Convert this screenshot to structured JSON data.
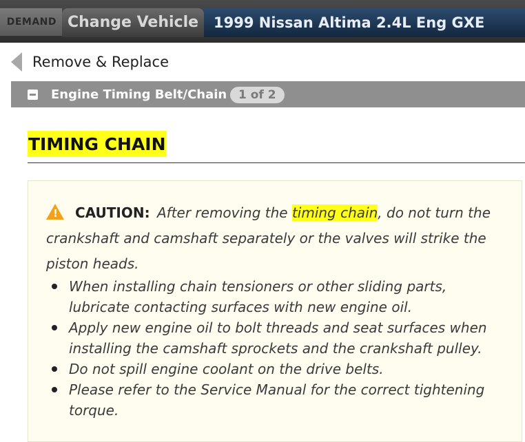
{
  "header": {
    "brand": "DEMAND",
    "change_vehicle_label": "Change Vehicle",
    "vehicle": "1999 Nissan Altima 2.4L Eng GXE"
  },
  "nav": {
    "back_label": "Remove & Replace"
  },
  "section": {
    "title": "Engine Timing Belt/Chain",
    "pager": "1 of 2"
  },
  "content": {
    "heading": "TIMING CHAIN",
    "caution": {
      "label": "CAUTION:",
      "text_before": "After removing the",
      "highlight": "timing chain",
      "text_after": ", do not turn the crankshaft and camshaft separately or the valves will strike the piston heads."
    },
    "bullets": [
      "When installing chain tensioners or other sliding parts, lubricate contacting surfaces with new engine oil.",
      "Apply new engine oil to bolt threads and seat surfaces when installing the camshaft sprockets and the crankshaft pulley.",
      "Do not spill engine coolant on the drive belts.",
      "Please refer to the Service Manual for the correct tightening torque."
    ]
  },
  "colors": {
    "highlight": "#ffff1a",
    "section_bar": "#8f8f8f",
    "caution_background": "#fffdef",
    "warning_icon": "#f0a31a",
    "vehicle_bar": "#1f3a5a"
  },
  "icons": {
    "back": "back-arrow-icon",
    "collapse": "minus-square-icon",
    "warning": "warning-triangle-icon"
  }
}
